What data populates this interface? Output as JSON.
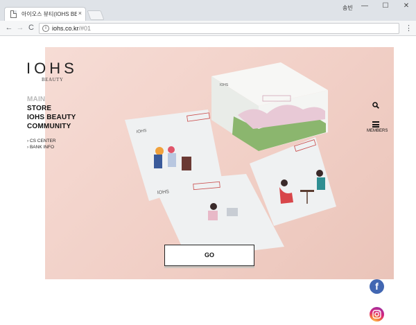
{
  "browser": {
    "tab_title": "아이오스 뷰티(IOHS BE",
    "tab_close": "×",
    "user_label": "송빈",
    "window_controls": {
      "minimize": "—",
      "maximize": "☐",
      "close": "✕"
    },
    "nav": {
      "back": "←",
      "forward": "→",
      "reload": "C"
    },
    "url_host": "iohs.co.kr",
    "url_path": "/#01",
    "menu": "⋮"
  },
  "site": {
    "logo": "IOHS",
    "logo_sub": "BEAUTY",
    "nav_items": [
      "MAIN",
      "STORE",
      "IOHS BEAUTY",
      "COMMUNITY"
    ],
    "active_nav": "MAIN",
    "sub_items": [
      "› CS CENTER",
      "› BANK INFO"
    ],
    "members_label": "MEMBERS",
    "cta_label": "GO",
    "social": {
      "facebook": "f",
      "instagram": "instagram-icon"
    },
    "packet_brand": "IOHS",
    "hero_bg": "#f1cfc6"
  }
}
